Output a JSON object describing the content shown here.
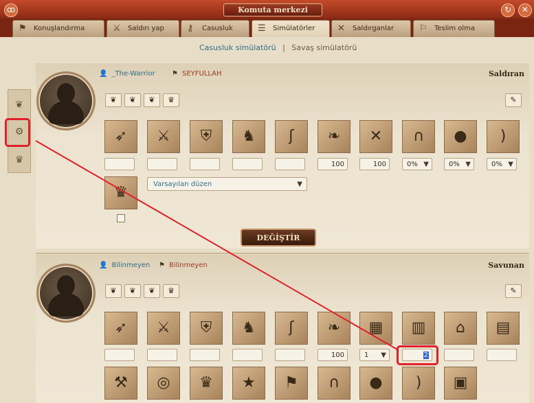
{
  "window": {
    "title": "Komuta merkezi",
    "left_icon": "swirl-icon",
    "refresh_icon": "refresh-icon",
    "close_icon": "close-icon"
  },
  "tabs": [
    {
      "label": "Konuşlandırma",
      "icon": "deploy-icon",
      "active": false
    },
    {
      "label": "Saldırı yap",
      "icon": "sword-icon",
      "active": false
    },
    {
      "label": "Casusluk",
      "icon": "keyhole-icon",
      "active": false
    },
    {
      "label": "Simülatörler",
      "icon": "scroll-icon",
      "active": true
    },
    {
      "label": "Saldırganlar",
      "icon": "crossed-swords-icon",
      "active": false
    },
    {
      "label": "Teslim olma",
      "icon": "white-flag-icon",
      "active": false
    }
  ],
  "sub_links": {
    "spy_sim": "Casusluk simülatörü",
    "separator": "|",
    "battle_sim": "Savaş simülatörü"
  },
  "side_tabs": [
    {
      "icon": "ram-icon"
    },
    {
      "icon": "gear-icon"
    },
    {
      "icon": "laurel-icon"
    }
  ],
  "attacker": {
    "player": "_The-Warrior",
    "clan": "SEYFULLAH",
    "role": "Saldıran",
    "preset_dropdown": "Varsayılan düzen",
    "unit_values": [
      "",
      "",
      "",
      "",
      "",
      "100",
      "100",
      "0%",
      "0%",
      "0%"
    ],
    "change_button": "DEĞİŞTİR"
  },
  "defender": {
    "player": "Bilinmeyen",
    "clan": "Bilinmeyen",
    "role": "Savunan",
    "unit_values": [
      "",
      "",
      "",
      "",
      "",
      "100",
      "1",
      "2",
      "",
      ""
    ]
  },
  "accent": {
    "highlight_box": "#e0202a",
    "link": "#2f6e8a",
    "clan": "#9a3a22"
  }
}
